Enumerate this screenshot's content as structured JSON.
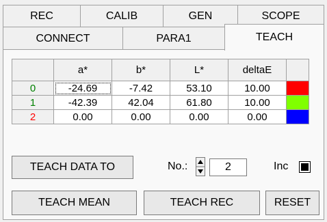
{
  "tabs_row1": [
    {
      "label": "REC"
    },
    {
      "label": "CALIB"
    },
    {
      "label": "GEN"
    },
    {
      "label": "SCOPE"
    }
  ],
  "tabs_row2": [
    {
      "label": "CONNECT"
    },
    {
      "label": "PARA1"
    },
    {
      "label": "TEACH",
      "active": true
    }
  ],
  "table": {
    "headers": [
      "a*",
      "b*",
      "L*",
      "deltaE"
    ],
    "rows": [
      {
        "index": "0",
        "index_color": "#008000",
        "a": "-24.69",
        "b": "-7.42",
        "L": "53.10",
        "deltaE": "10.00",
        "swatch": "#ff0000",
        "selected": true
      },
      {
        "index": "1",
        "index_color": "#008000",
        "a": "-42.39",
        "b": "42.04",
        "L": "61.80",
        "deltaE": "10.00",
        "swatch": "#80ff00"
      },
      {
        "index": "2",
        "index_color": "#ff0000",
        "a": "0.00",
        "b": "0.00",
        "L": "0.00",
        "deltaE": "0.00",
        "swatch": "#0000ff"
      }
    ]
  },
  "controls": {
    "teach_data_to": "TEACH DATA TO",
    "no_label": "No.:",
    "no_value": "2",
    "inc_label": "Inc",
    "inc_checked": true,
    "teach_mean": "TEACH MEAN",
    "teach_rec": "TEACH REC",
    "reset": "RESET"
  }
}
